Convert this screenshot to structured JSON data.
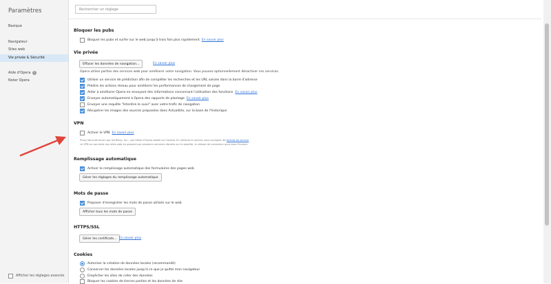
{
  "sidebar": {
    "title": "Paramètres",
    "items": [
      {
        "label": "Basique"
      },
      {
        "label": "Navigateur"
      },
      {
        "label": "Sites web"
      },
      {
        "label": "Vie privée & Sécurité"
      },
      {
        "label": "Aide d'Opera"
      },
      {
        "label": "Noter Opera"
      }
    ],
    "advanced_label": "Afficher les réglages avancés"
  },
  "search": {
    "placeholder": "Rechercher un réglage"
  },
  "ads": {
    "title": "Bloquer les pubs",
    "checkbox_label": "Bloquer les pubs et surfer sur le web jusqu'à trois fois plus rapidement",
    "link": "En savoir plus"
  },
  "privacy": {
    "title": "Vie privée",
    "clear_button": "Effacer les données de navigation...",
    "link": "En savoir plus",
    "info": "Opera utilise parfois des services web pour améliorer votre navigation. Vous pouvez optionnellement désactiver ces services.",
    "options": [
      {
        "label": "Utiliser un service de prédiction afin de compléter les recherches et les URL saisies dans la barre d'adresse",
        "link": ""
      },
      {
        "label": "Prédire les actions réseau pour améliorer les performances de chargement de page",
        "link": ""
      },
      {
        "label": "Aider à améliorer Opera en envoyant des informations concernant l'utilisation des fonctions",
        "link": "En savoir plus"
      },
      {
        "label": "Envoyer automatiquement à Opera des rapports de plantage",
        "link": "En savoir plus"
      },
      {
        "label": "Envoyer une requête \"Interdire le suivi\" avec votre trafic de navigation",
        "link": ""
      },
      {
        "label": "Récupérer les images des sources proposées dans Actualités, sur la base de l'historique",
        "link": ""
      }
    ]
  },
  "vpn": {
    "title": "VPN",
    "checkbox_label": "Activer le VPN",
    "link": "En savoir plus",
    "desc1": "Proxy sécurisé fourni par SurfEasy, Inc., une filiale d'Opera basée au Canada. En utilisant le service vous acceptez les",
    "desc1_link": "termes du service",
    "desc2": "Le VPN se connecte aux sites web en passant par plusieurs serveurs répartis sur la planète, la vitesse de connexion peut donc fluctuer."
  },
  "autofill": {
    "title": "Remplissage automatique",
    "checkbox_label": "Activer le remplissage automatique des formulaires des pages web",
    "button": "Gérer les réglages du remplissage automatique"
  },
  "passwords": {
    "title": "Mots de passe",
    "checkbox_label": "Proposer d'enregistrer les mots de passe utilisés sur le web",
    "button": "Afficher tous les mots de passe"
  },
  "https": {
    "title": "HTTPS/SSL",
    "button": "Gérer les certificats...",
    "link": "En savoir plus"
  },
  "cookies": {
    "title": "Cookies",
    "options": [
      {
        "label": "Autoriser la création de données locales (recommandé)"
      },
      {
        "label": "Conserver les données locales jusqu'à ce que je quitte mon navigateur"
      },
      {
        "label": "Empêcher les sites de créer des données"
      },
      {
        "label": "Bloquer les cookies de tierces parties et les données de site"
      }
    ]
  },
  "colors": {
    "accent": "#4a90d9",
    "link": "#2a6fd6",
    "arrow": "#e0443a"
  }
}
